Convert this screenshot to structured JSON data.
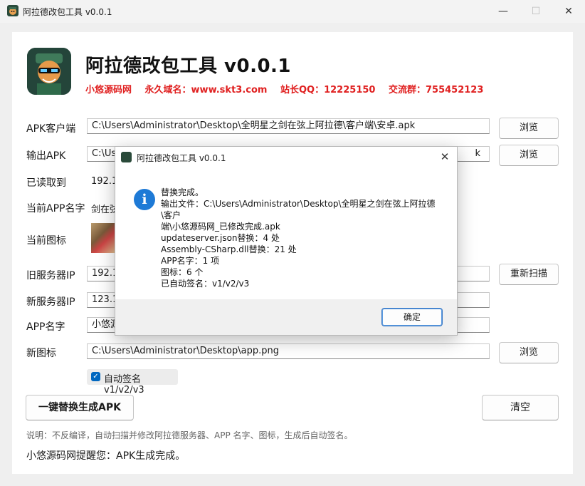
{
  "window": {
    "title": "阿拉德改包工具 v0.0.1",
    "min_glyph": "—",
    "max_glyph": "☐",
    "close_glyph": "✕"
  },
  "header": {
    "title": "阿拉德改包工具 v0.0.1",
    "promo": [
      "小悠源码网",
      "永久域名：www.skt3.com",
      "站长QQ：12225150",
      "交流群：755452123"
    ],
    "promo_color": "#e02020"
  },
  "form": {
    "apk_client_label": "APK客户端",
    "apk_client_value": "C:\\Users\\Administrator\\Desktop\\全明星之剑在弦上阿拉德\\客户端\\安卓.apk",
    "output_apk_label": "输出APK",
    "output_apk_value_start": "C:\\Us",
    "output_apk_value_end": "k",
    "read_label": "已读取到",
    "read_value": "192.1",
    "app_name_current_label": "当前APP名字",
    "app_name_current_value": "剑在弦",
    "icon_current_label": "当前图标",
    "old_server_label": "旧服务器IP",
    "old_server_value": "192.1",
    "new_server_label": "新服务器IP",
    "new_server_value": "123.1",
    "app_name_label": "APP名字",
    "app_name_value": "小悠源",
    "new_icon_label": "新图标",
    "new_icon_value": "C:\\Users\\Administrator\\Desktop\\app.png",
    "browse_label": "浏览",
    "rescan_label": "重新扫描",
    "auto_sign_label": "自动签名 v1/v2/v3",
    "auto_sign_checked": true
  },
  "actions": {
    "generate_label": "一键替换生成APK",
    "clear_label": "清空"
  },
  "note": "说明：不反编译，自动扫描并修改阿拉德服务器、APP 名字、图标，生成后自动签名。",
  "status": "小悠源码网提醒您：APK生成完成。",
  "dialog": {
    "title": "阿拉德改包工具 v0.0.1",
    "icon": "info-icon",
    "lines": [
      "替换完成。",
      "输出文件：C:\\Users\\Administrator\\Desktop\\全明星之剑在弦上阿拉德\\客户",
      "端\\小悠源码网_已修改完成.apk",
      "updateserver.json替换：4 处",
      "Assembly-CSharp.dll替换：21 处",
      "APP名字：1 项",
      "图标：6 个",
      "已自动签名：v1/v2/v3"
    ],
    "ok_label": "确定",
    "close_glyph": "✕"
  }
}
